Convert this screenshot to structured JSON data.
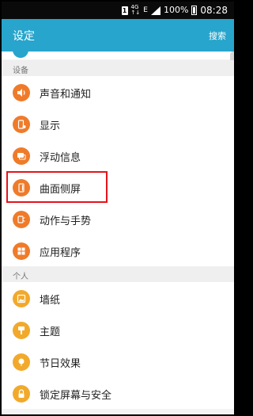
{
  "status_bar": {
    "sim": "1",
    "network_top": "4G",
    "network_bottom": "↑↓",
    "signal_type": "E",
    "battery_percent": "100%",
    "time": "08:28"
  },
  "app_bar": {
    "title": "设定",
    "search_label": "搜索"
  },
  "sections": [
    {
      "header": "设备",
      "items": [
        {
          "label": "声音和通知",
          "icon": "speaker-icon",
          "color": "#ef7b2a"
        },
        {
          "label": "显示",
          "icon": "display-icon",
          "color": "#ef7b2a"
        },
        {
          "label": "浮动信息",
          "icon": "message-icon",
          "color": "#ef7b2a"
        },
        {
          "label": "曲面侧屏",
          "icon": "edge-screen-icon",
          "color": "#ef7b2a"
        },
        {
          "label": "动作与手势",
          "icon": "gesture-icon",
          "color": "#ef7b2a"
        },
        {
          "label": "应用程序",
          "icon": "apps-icon",
          "color": "#ef7b2a"
        }
      ]
    },
    {
      "header": "个人",
      "items": [
        {
          "label": "墙纸",
          "icon": "wallpaper-icon",
          "color": "#f2a92b"
        },
        {
          "label": "主题",
          "icon": "theme-icon",
          "color": "#f2a92b"
        },
        {
          "label": "节日效果",
          "icon": "festival-icon",
          "color": "#f2a92b"
        },
        {
          "label": "锁定屏幕与安全",
          "icon": "lock-icon",
          "color": "#f2a92b"
        }
      ]
    }
  ],
  "highlighted_item": "曲面侧屏"
}
